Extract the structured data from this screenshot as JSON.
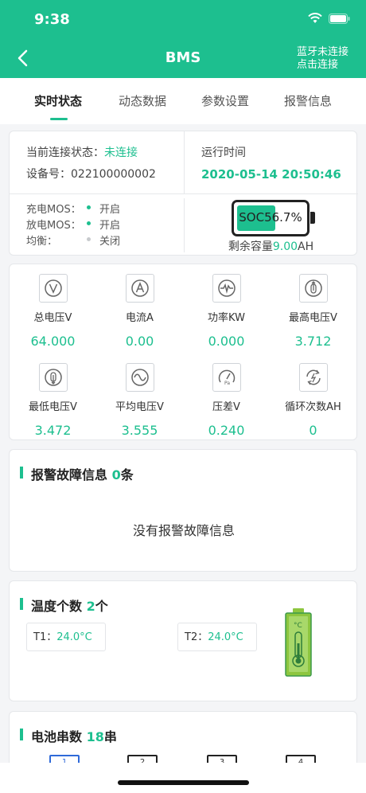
{
  "status_bar": {
    "time": "9:38"
  },
  "nav": {
    "title": "BMS",
    "bt_line1": "蓝牙未连接",
    "bt_line2": "点击连接"
  },
  "tabs": [
    {
      "label": "实时状态",
      "active": true
    },
    {
      "label": "动态数据",
      "active": false
    },
    {
      "label": "参数设置",
      "active": false
    },
    {
      "label": "报警信息",
      "active": false
    }
  ],
  "info": {
    "conn_label": "当前连接状态：",
    "conn_value": "未连接",
    "device_label": "设备号：",
    "device_value": "022100000002",
    "runtime_label": "运行时间",
    "runtime_value": "2020-05-14 20:50:46",
    "charge_label": "充电MOS：",
    "charge_value": "开启",
    "discharge_label": "放电MOS：",
    "discharge_value": "开启",
    "balance_label": "均衡：",
    "balance_value": "关闭",
    "soc_label": "SOC56.7%",
    "soc_fraction": 0.567,
    "remain_label": "剩余容量",
    "remain_value": "9.00",
    "remain_unit": "AH"
  },
  "metrics": [
    {
      "label": "总电压V",
      "value": "64.000",
      "icon": "voltage-icon"
    },
    {
      "label": "电流A",
      "value": "0.00",
      "icon": "current-icon"
    },
    {
      "label": "功率KW",
      "value": "0.000",
      "icon": "power-icon"
    },
    {
      "label": "最高电压V",
      "value": "3.712",
      "icon": "max-voltage-icon"
    },
    {
      "label": "最低电压V",
      "value": "3.472",
      "icon": "min-voltage-icon"
    },
    {
      "label": "平均电压V",
      "value": "3.555",
      "icon": "avg-voltage-icon"
    },
    {
      "label": "压差V",
      "value": "0.240",
      "icon": "pressure-diff-icon"
    },
    {
      "label": "循环次数AH",
      "value": "0",
      "icon": "cycle-icon"
    }
  ],
  "alarm": {
    "title": "报警故障信息",
    "count": "0",
    "unit": "条",
    "empty_text": "没有报警故障信息"
  },
  "temperature": {
    "title": "温度个数",
    "count": "2",
    "unit": "个",
    "sensors": [
      {
        "label": "T1：",
        "value": "24.0°C"
      },
      {
        "label": "T2：",
        "value": "24.0°C"
      }
    ],
    "thermo_unit": "°C"
  },
  "cells": {
    "title": "电池串数",
    "count": "18",
    "unit": "串",
    "visible": [
      "1",
      "2",
      "3",
      "4"
    ]
  },
  "colors": {
    "accent": "#1dbf8f",
    "cell_highlight": "#2f6ad9"
  }
}
